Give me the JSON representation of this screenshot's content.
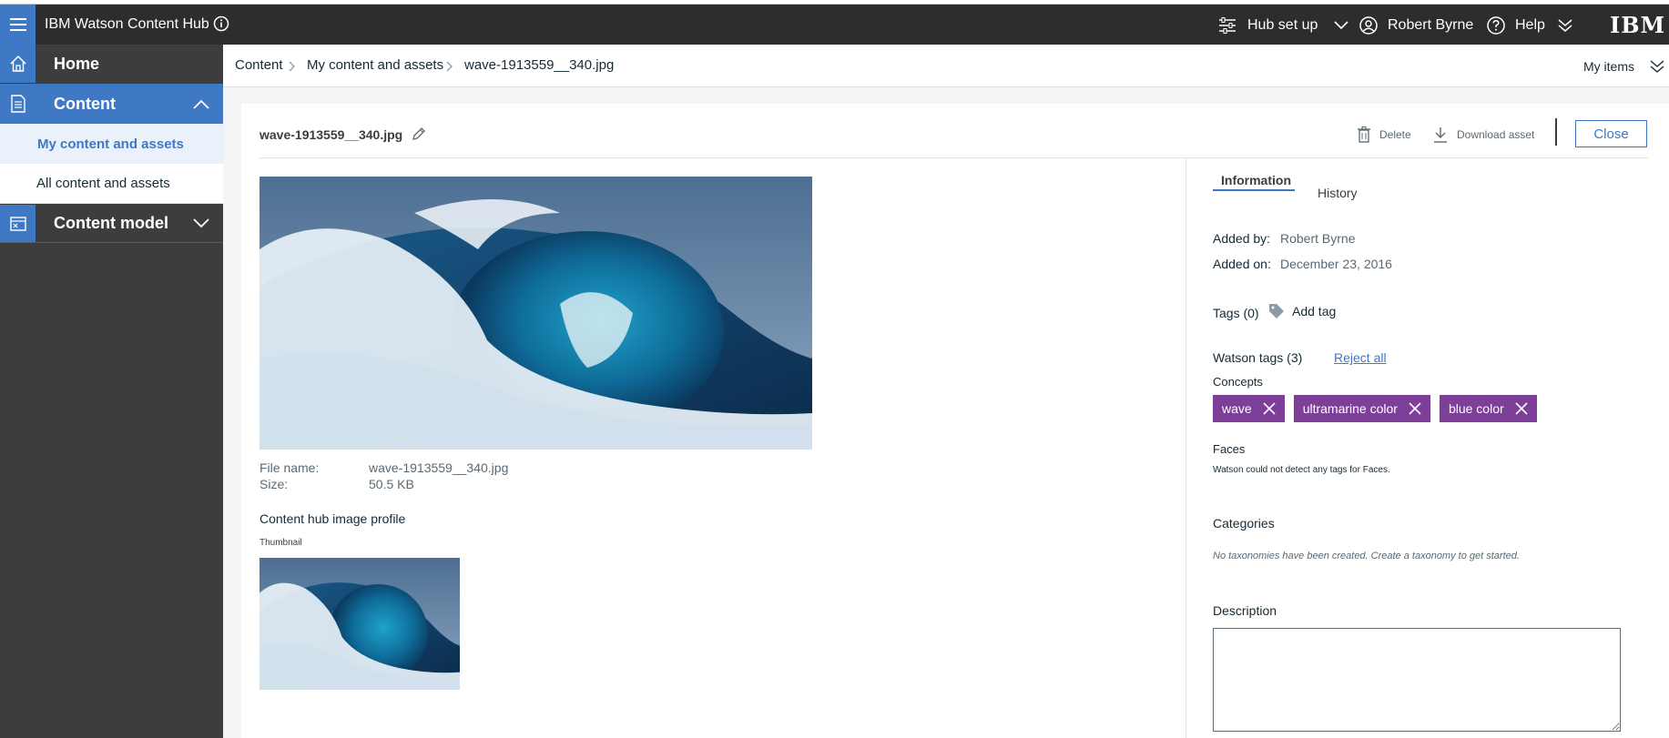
{
  "header": {
    "app_title": "IBM Watson Content Hub",
    "hub_setup_label": "Hub set up",
    "user_name": "Robert Byrne",
    "help_label": "Help",
    "ibm_logo": "IBM"
  },
  "sidebar": {
    "home_label": "Home",
    "content_label": "Content",
    "my_content_label": "My content and assets",
    "all_content_label": "All content and assets",
    "content_model_label": "Content model"
  },
  "breadcrumb": {
    "items": [
      "Content",
      "My content and assets",
      "wave-1913559__340.jpg"
    ],
    "my_items_label": "My items"
  },
  "asset": {
    "title": "wave-1913559__340.jpg",
    "delete_label": "Delete",
    "download_label": "Download asset",
    "close_label": "Close",
    "file_name_label": "File name:",
    "file_name_value": "wave-1913559__340.jpg",
    "size_label": "Size:",
    "size_value": "50.5 KB",
    "profile_title": "Content hub image profile",
    "thumbnail_label": "Thumbnail"
  },
  "info_panel": {
    "tab_information": "Information",
    "tab_history": "History",
    "added_by_label": "Added by:",
    "added_by_value": "Robert Byrne",
    "added_on_label": "Added on:",
    "added_on_value": "December 23, 2016",
    "tags_label": "Tags (0)",
    "add_tag_label": "Add tag",
    "watson_tags_label": "Watson tags (3)",
    "reject_all_label": "Reject all",
    "concepts_label": "Concepts",
    "concept_tags": [
      "wave",
      "ultramarine color",
      "blue color"
    ],
    "faces_label": "Faces",
    "faces_message": "Watson could not detect any tags for Faces.",
    "categories_label": "Categories",
    "categories_message": "No taxonomies have been created. Create a taxonomy to get started.",
    "description_label": "Description",
    "description_value": ""
  },
  "colors": {
    "accent": "#3f78c4",
    "topbar": "#2d2d2d",
    "sidebar": "#3d3d3d",
    "tag": "#7d3f98"
  }
}
